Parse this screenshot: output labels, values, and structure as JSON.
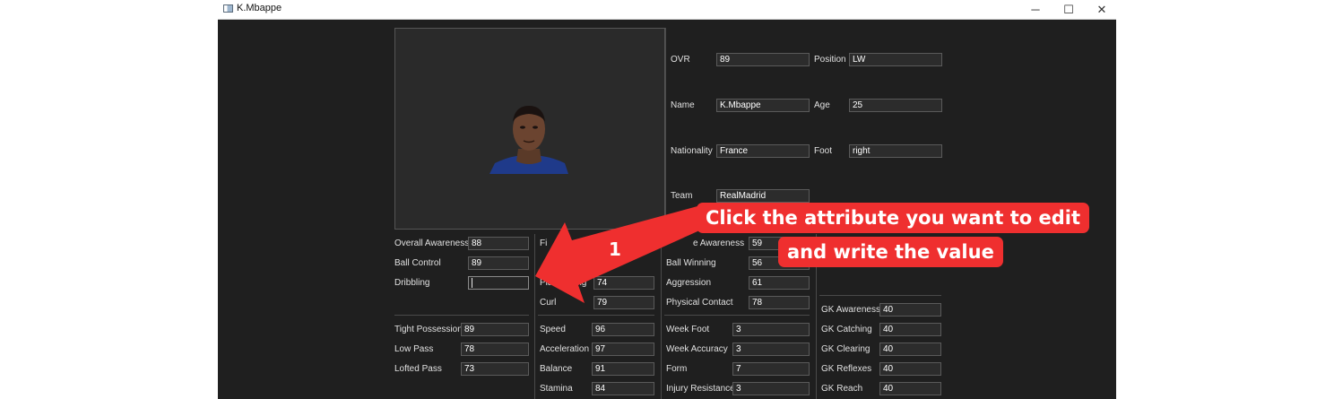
{
  "window": {
    "title": "K.Mbappe",
    "minimize_glyph": "─",
    "maximize_glyph": "☐",
    "close_glyph": "✕"
  },
  "profile": {
    "ovr": {
      "label": "OVR",
      "value": "89"
    },
    "position": {
      "label": "Position",
      "value": "LW"
    },
    "name": {
      "label": "Name",
      "value": "K.Mbappe"
    },
    "age": {
      "label": "Age",
      "value": "25"
    },
    "nationality": {
      "label": "Nationality",
      "value": "France"
    },
    "foot": {
      "label": "Foot",
      "value": "right"
    },
    "team": {
      "label": "Team",
      "value": "RealMadrid"
    }
  },
  "attributes": {
    "col1a": [
      {
        "label": "Overall Awareness",
        "value": "88"
      },
      {
        "label": "Ball Control",
        "value": "89"
      },
      {
        "label": "Dribbling",
        "value": ""
      }
    ],
    "col1b": [
      {
        "label": "Tight Possession",
        "value": "89"
      },
      {
        "label": "Low Pass",
        "value": "78"
      },
      {
        "label": "Lofted Pass",
        "value": "73"
      }
    ],
    "col2_top": {
      "label_start": "Fi"
    },
    "col2_mid": [
      {
        "label_start": "Pla",
        "label_end": "ing",
        "value": "74"
      },
      {
        "label": "Curl",
        "value": "79"
      }
    ],
    "col2b": [
      {
        "label": "Speed",
        "value": "96"
      },
      {
        "label": "Acceleration",
        "value": "97"
      },
      {
        "label": "Balance",
        "value": "91"
      },
      {
        "label": "Stamina",
        "value": "84"
      }
    ],
    "col3_top": {
      "label_end": "e Awareness",
      "value": "59"
    },
    "col3a": [
      {
        "label": "Ball Winning",
        "value": "56"
      },
      {
        "label": "Aggression",
        "value": "61"
      },
      {
        "label": "Physical Contact",
        "value": "78"
      }
    ],
    "col3b": [
      {
        "label": "Week Foot",
        "value": "3"
      },
      {
        "label": "Week Accuracy",
        "value": "3"
      },
      {
        "label": "Form",
        "value": "7"
      },
      {
        "label": "Injury Resistance",
        "value": "3"
      }
    ],
    "col4": [
      {
        "label": "GK Awareness",
        "value": "40"
      },
      {
        "label": "GK Catching",
        "value": "40"
      },
      {
        "label": "GK Clearing",
        "value": "40"
      },
      {
        "label": "GK Reflexes",
        "value": "40"
      },
      {
        "label": "GK Reach",
        "value": "40"
      }
    ]
  },
  "annotation": {
    "step_number": "1",
    "line1": "Click the attribute you want to edit",
    "line2": "and write the value",
    "color": "#ef2f2f"
  }
}
